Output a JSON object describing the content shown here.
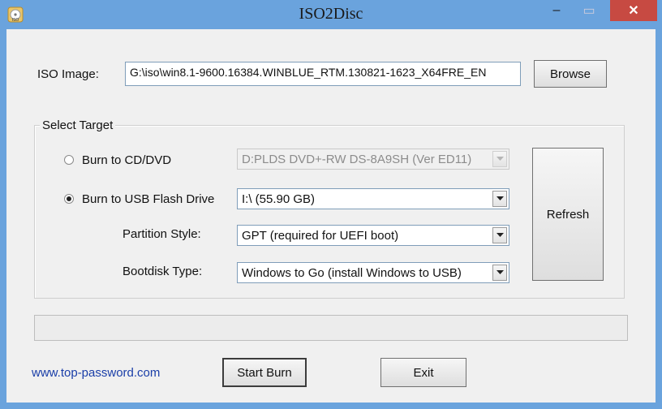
{
  "window": {
    "title": "ISO2Disc",
    "minimize_glyph": "–",
    "maximize_glyph": "▭",
    "close_glyph": "✕"
  },
  "iso": {
    "label": "ISO Image:",
    "path": "G:\\iso\\win8.1-9600.16384.WINBLUE_RTM.130821-1623_X64FRE_EN",
    "browse_label": "Browse"
  },
  "target": {
    "legend": "Select Target",
    "burn_cd_label": "Burn to CD/DVD",
    "burn_cd_selected": false,
    "cd_drive": "D:PLDS DVD+-RW DS-8A9SH (Ver ED11)",
    "burn_usb_label": "Burn to USB Flash Drive",
    "burn_usb_selected": true,
    "usb_drive": "I:\\ (55.90 GB)",
    "partition_label": "Partition Style:",
    "partition_value": "GPT (required for UEFI boot)",
    "bootdisk_label": "Bootdisk Type:",
    "bootdisk_value": "Windows to Go (install Windows to USB)",
    "refresh_label": "Refresh"
  },
  "progress": {
    "fraction": 0
  },
  "footer": {
    "website": "www.top-password.com",
    "start_label": "Start Burn",
    "exit_label": "Exit"
  },
  "colors": {
    "title_bar": "#6aa3dd",
    "close_button": "#c74a42",
    "link": "#1a3ea8"
  }
}
